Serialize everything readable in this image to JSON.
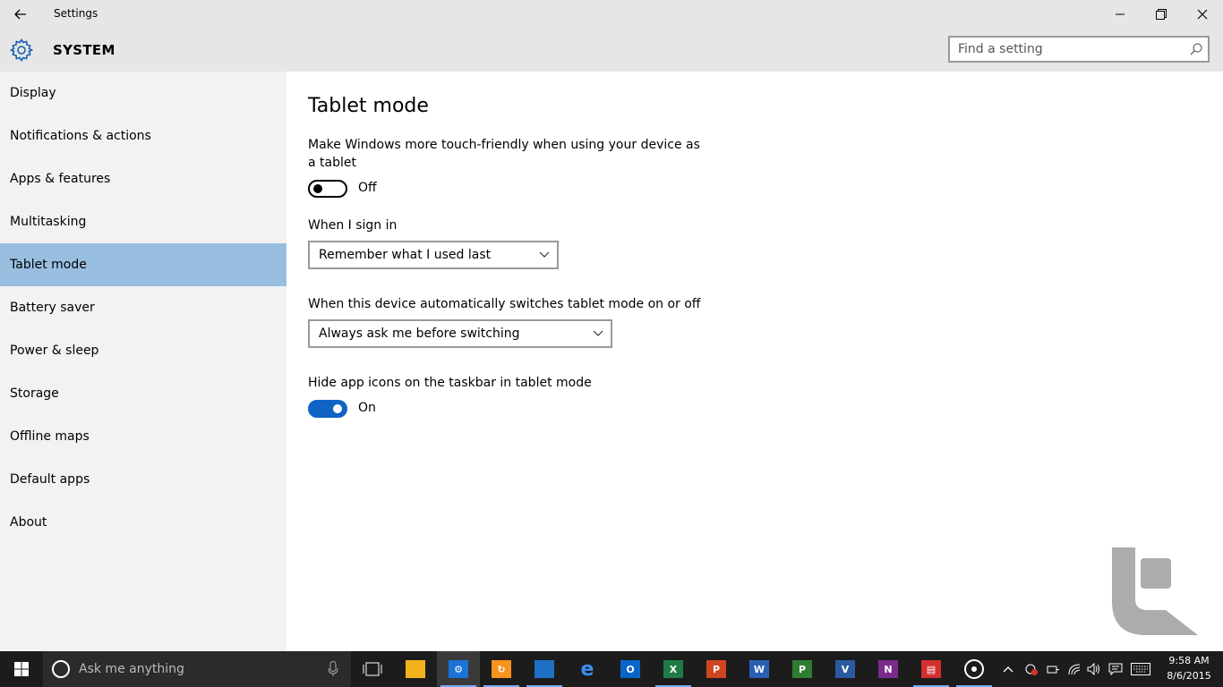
{
  "window": {
    "title": "Settings",
    "back_icon": "back-arrow-icon",
    "minimize_icon": "minimize-icon",
    "restore_icon": "restore-icon",
    "close_icon": "close-icon"
  },
  "header": {
    "icon": "gear-icon",
    "title": "SYSTEM",
    "search_placeholder": "Find a setting"
  },
  "sidebar": {
    "selected": "Tablet mode",
    "items": [
      {
        "label": "Display"
      },
      {
        "label": "Notifications & actions"
      },
      {
        "label": "Apps & features"
      },
      {
        "label": "Multitasking"
      },
      {
        "label": "Tablet mode"
      },
      {
        "label": "Battery saver"
      },
      {
        "label": "Power & sleep"
      },
      {
        "label": "Storage"
      },
      {
        "label": "Offline maps"
      },
      {
        "label": "Default apps"
      },
      {
        "label": "About"
      }
    ]
  },
  "main": {
    "title": "Tablet mode",
    "touch_friendly": {
      "label": "Make Windows more touch-friendly when using your device as a tablet",
      "state": "Off"
    },
    "sign_in": {
      "label": "When I sign in",
      "value": "Remember what I used last"
    },
    "auto_switch": {
      "label": "When this device automatically switches tablet mode on or off",
      "value": "Always ask me before switching"
    },
    "hide_icons": {
      "label": "Hide app icons on the taskbar in tablet mode",
      "state": "On"
    }
  },
  "taskbar": {
    "search_placeholder": "Ask me anything",
    "apps": [
      {
        "name": "task-view",
        "letter": ""
      },
      {
        "name": "file-explorer",
        "letter": ""
      },
      {
        "name": "settings",
        "letter": ""
      },
      {
        "name": "app-orange",
        "letter": ""
      },
      {
        "name": "app-blue",
        "letter": ""
      },
      {
        "name": "edge",
        "letter": "e"
      },
      {
        "name": "outlook",
        "letter": "O"
      },
      {
        "name": "excel",
        "letter": "X"
      },
      {
        "name": "powerpoint",
        "letter": "P"
      },
      {
        "name": "word",
        "letter": "W"
      },
      {
        "name": "project",
        "letter": "P"
      },
      {
        "name": "visio",
        "letter": "V"
      },
      {
        "name": "onenote",
        "letter": "N"
      },
      {
        "name": "news",
        "letter": ""
      },
      {
        "name": "groove",
        "letter": ""
      }
    ],
    "time": "9:58 AM",
    "date": "8/6/2015"
  },
  "colors": {
    "accent": "#0f63c5",
    "selected_nav": "#99bfe0",
    "sidebar_bg": "#f2f2f2",
    "titlebar_bg": "#e6e6e6",
    "taskbar_bg": "#1c1c1c"
  }
}
